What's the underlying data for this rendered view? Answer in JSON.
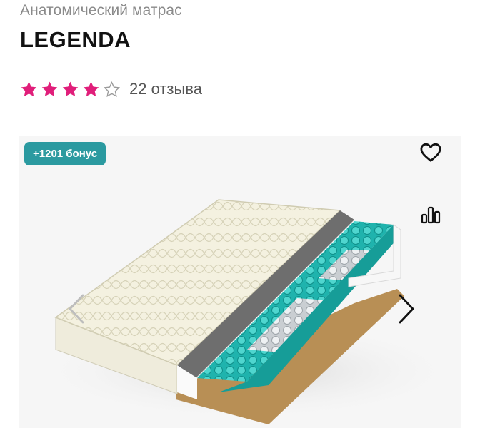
{
  "product": {
    "category": "Анатомический матрас",
    "name": "LEGENDA"
  },
  "rating": {
    "stars": 4,
    "max_stars": 5,
    "reviews_text": "22 отзыва",
    "star_color": "#e01e7a"
  },
  "gallery": {
    "bonus_badge": "+1201 бонус",
    "badge_color": "#2b9aa0",
    "image_subject": "mattress-cutaway-image",
    "icons": [
      "heart-icon",
      "compare-chart-icon",
      "chevron-left-icon",
      "chevron-right-icon"
    ]
  }
}
